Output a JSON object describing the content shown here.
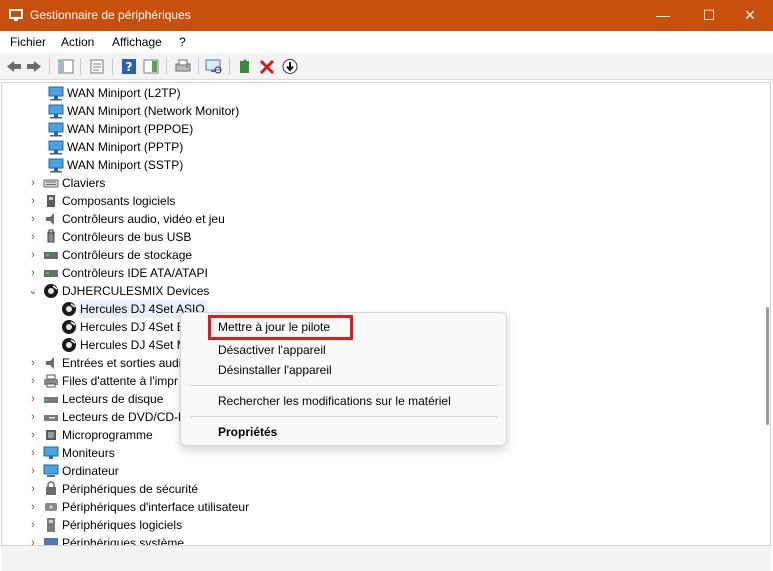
{
  "window": {
    "title": "Gestionnaire de périphériques",
    "minimize": "—",
    "maximize": "☐",
    "close": "✕"
  },
  "menu": [
    {
      "label": "Fichier"
    },
    {
      "label": "Action"
    },
    {
      "label": "Affichage"
    },
    {
      "label": "?"
    }
  ],
  "tree": {
    "wan": [
      "WAN Miniport (L2TP)",
      "WAN Miniport (Network Monitor)",
      "WAN Miniport (PPPOE)",
      "WAN Miniport (PPTP)",
      "WAN Miniport (SSTP)"
    ],
    "categories_before": [
      {
        "label": "Claviers",
        "icon": "keyboard-icon"
      },
      {
        "label": "Composants logiciels",
        "icon": "software-component-icon"
      },
      {
        "label": "Contrôleurs audio, vidéo et jeu",
        "icon": "audio-icon"
      },
      {
        "label": "Contrôleurs de bus USB",
        "icon": "usb-icon"
      },
      {
        "label": "Contrôleurs de stockage",
        "icon": "storage-icon"
      },
      {
        "label": "Contrôleurs IDE ATA/ATAPI",
        "icon": "ide-icon"
      }
    ],
    "expanded_category": {
      "label": "DJHERCULESMIX Devices",
      "icon": "dj-icon"
    },
    "dj_devices": [
      "Hercules DJ 4Set ASIO",
      "Hercules DJ 4Set B",
      "Hercules DJ 4Set M"
    ],
    "categories_after": [
      {
        "label": "Entrées et sorties audio",
        "icon": "audio-io-icon"
      },
      {
        "label": "Files d'attente à l'impr",
        "icon": "printer-icon"
      },
      {
        "label": "Lecteurs de disque",
        "icon": "disk-icon"
      },
      {
        "label": "Lecteurs de DVD/CD-R",
        "icon": "dvd-icon"
      },
      {
        "label": "Microprogramme",
        "icon": "firmware-icon"
      },
      {
        "label": "Moniteurs",
        "icon": "monitor-icon"
      },
      {
        "label": "Ordinateur",
        "icon": "computer-icon"
      },
      {
        "label": "Périphériques de sécurité",
        "icon": "security-icon"
      },
      {
        "label": "Périphériques d'interface utilisateur",
        "icon": "hid-icon"
      },
      {
        "label": "Périphériques logiciels",
        "icon": "software-device-icon"
      },
      {
        "label": "Périphériques système",
        "icon": "system-icon"
      }
    ]
  },
  "context_menu": {
    "update_driver": "Mettre à jour le pilote",
    "disable": "Désactiver l'appareil",
    "uninstall": "Désinstaller l'appareil",
    "scan": "Rechercher les modifications sur le matériel",
    "properties": "Propriétés"
  },
  "colors": {
    "titlebar": "#c94f0c",
    "highlight": "#e01b1b",
    "selection": "#e6f0fb"
  }
}
